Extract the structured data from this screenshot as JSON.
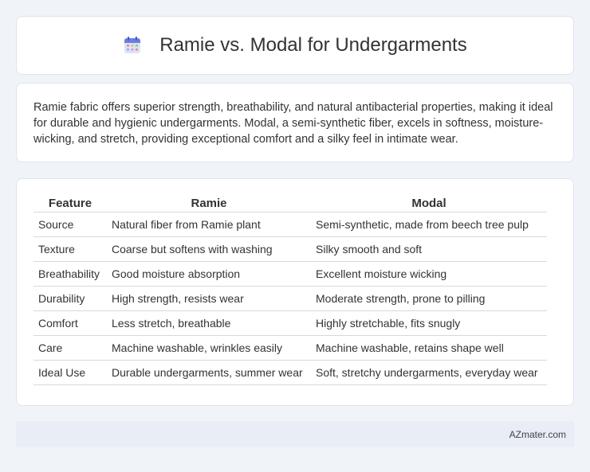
{
  "header": {
    "title": "Ramie vs. Modal for Undergarments",
    "icon": "calendar-icon"
  },
  "intro": {
    "text": "Ramie fabric offers superior strength, breathability, and natural antibacterial properties, making it ideal for durable and hygienic undergarments. Modal, a semi-synthetic fiber, excels in softness, moisture-wicking, and stretch, providing exceptional comfort and a silky feel in intimate wear."
  },
  "table": {
    "headers": [
      "Feature",
      "Ramie",
      "Modal"
    ],
    "rows": [
      [
        "Source",
        "Natural fiber from Ramie plant",
        "Semi-synthetic, made from beech tree pulp"
      ],
      [
        "Texture",
        "Coarse but softens with washing",
        "Silky smooth and soft"
      ],
      [
        "Breathability",
        "Good moisture absorption",
        "Excellent moisture wicking"
      ],
      [
        "Durability",
        "High strength, resists wear",
        "Moderate strength, prone to pilling"
      ],
      [
        "Comfort",
        "Less stretch, breathable",
        "Highly stretchable, fits snugly"
      ],
      [
        "Care",
        "Machine washable, wrinkles easily",
        "Machine washable, retains shape well"
      ],
      [
        "Ideal Use",
        "Durable undergarments, summer wear",
        "Soft, stretchy undergarments, everyday wear"
      ]
    ]
  },
  "footer": {
    "source": "AZmater.com"
  },
  "colors": {
    "background": "#f0f3f8",
    "card": "#ffffff",
    "footer_bg": "#e8edf6",
    "text": "#333333"
  }
}
